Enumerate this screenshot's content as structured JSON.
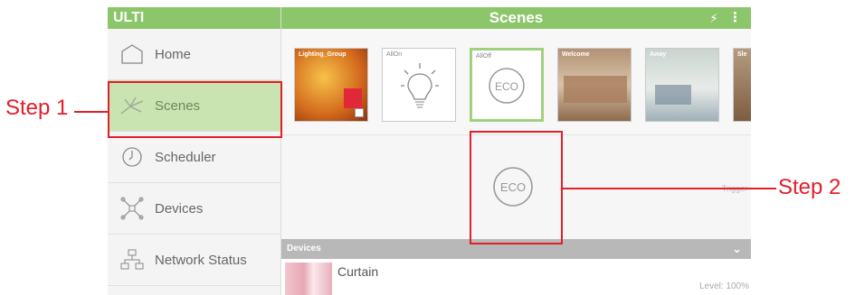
{
  "sidebar": {
    "title": "ULTI",
    "items": [
      {
        "label": "Home",
        "icon": "home-icon"
      },
      {
        "label": "Scenes",
        "icon": "scenes-icon",
        "active": true
      },
      {
        "label": "Scheduler",
        "icon": "clock-icon"
      },
      {
        "label": "Devices",
        "icon": "devices-icon"
      },
      {
        "label": "Network Status",
        "icon": "network-icon"
      }
    ]
  },
  "header": {
    "title": "Scenes",
    "bolt_icon": "bolt-icon",
    "menu_icon": "more-icon"
  },
  "scenes": [
    {
      "label": "Lighting_Group"
    },
    {
      "label": "AllOn"
    },
    {
      "label": "AllOff",
      "selected": true
    },
    {
      "label": "Welcome"
    },
    {
      "label": "Away"
    },
    {
      "label": "Sle"
    }
  ],
  "preview": {
    "eco_text": "ECO",
    "trigger_text": "Trigger"
  },
  "devices": {
    "section_title": "Devices",
    "items": [
      {
        "name": "Curtain",
        "level": "Level: 100%"
      }
    ]
  },
  "annotations": {
    "step1": "Step 1",
    "step2": "Step 2"
  },
  "colors": {
    "accent": "#8cc66a",
    "active_item": "#c9e3b1",
    "annotation": "#e0202a"
  }
}
